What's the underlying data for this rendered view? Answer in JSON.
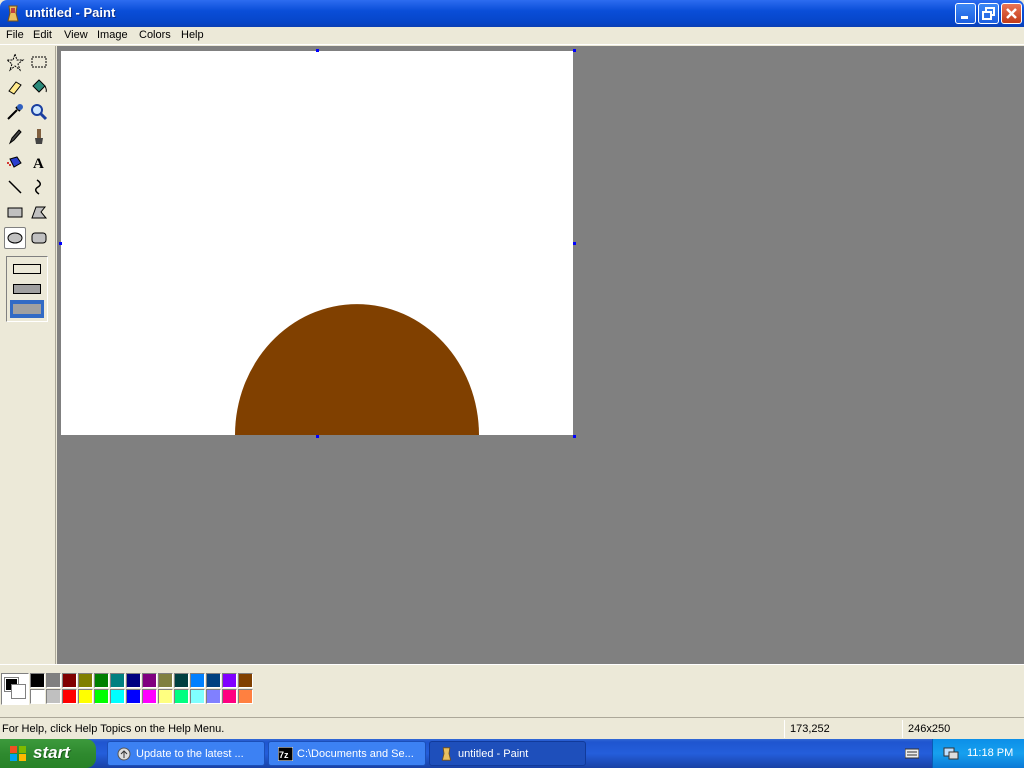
{
  "window": {
    "title": "untitled - Paint"
  },
  "menu": [
    "File",
    "Edit",
    "View",
    "Image",
    "Colors",
    "Help"
  ],
  "tools": [
    "free-form-select",
    "select",
    "eraser",
    "fill-with-color",
    "pick-color",
    "magnifier",
    "pencil",
    "brush",
    "airbrush",
    "text",
    "line",
    "curve",
    "rectangle",
    "polygon",
    "ellipse",
    "rounded-rectangle"
  ],
  "selected_tool": "ellipse",
  "selected_fill_option": "filled-no-outline",
  "canvas": {
    "shape": "filled semicircle",
    "shape_color": "#804000",
    "background": "#ffffff"
  },
  "colors": {
    "foreground": "#000000",
    "background": "#ffffff",
    "palette_top": [
      "#000000",
      "#808080",
      "#800000",
      "#808000",
      "#008000",
      "#008080",
      "#000080",
      "#800080",
      "#808040",
      "#004040",
      "#0080ff",
      "#004080",
      "#8000ff",
      "#804000"
    ],
    "palette_bottom": [
      "#ffffff",
      "#c0c0c0",
      "#ff0000",
      "#ffff00",
      "#00ff00",
      "#00ffff",
      "#0000ff",
      "#ff00ff",
      "#ffff80",
      "#00ff80",
      "#80ffff",
      "#8080ff",
      "#ff0080",
      "#ff8040"
    ]
  },
  "status": {
    "help": "For Help, click Help Topics on the Help Menu.",
    "coords": "173,252",
    "size": "246x250"
  },
  "taskbar": {
    "start": "start",
    "tasks": [
      "Update to the latest ...",
      "C:\\Documents and Se...",
      "untitled - Paint"
    ],
    "clock": "11:18 PM"
  }
}
